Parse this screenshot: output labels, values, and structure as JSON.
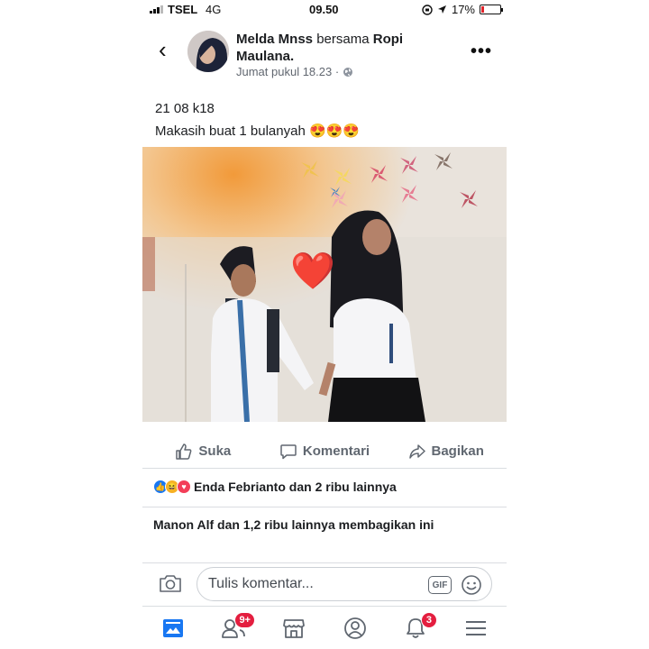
{
  "status_bar": {
    "carrier": "TSEL",
    "network": "4G",
    "time": "09.50",
    "battery": "17%",
    "battery_level": 0.17,
    "battery_color": "#e0242b"
  },
  "post": {
    "author": "Melda Mnss",
    "with_text": "bersama",
    "tagged": "Ropi Maulana.",
    "timestamp": "Jumat pukul 18.23 ·",
    "privacy_icon": "globe-icon",
    "text_line1": "21 08 k18",
    "text_line2": "Makasih buat 1 bulanyah",
    "emojis": "😍😍😍",
    "photo_overlay_emoji": "❤️"
  },
  "actions": {
    "like": "Suka",
    "comment": "Komentari",
    "share": "Bagikan"
  },
  "reactions": {
    "icons": [
      "like-reaction-icon",
      "haha-reaction-icon",
      "love-reaction-icon"
    ],
    "summary": "Enda Febrianto dan 2 ribu lainnya"
  },
  "shares": {
    "summary": "Manon Alf dan 1,2 ribu lainnya membagikan ini"
  },
  "comment_bar": {
    "placeholder": "Tulis komentar...",
    "gif_label": "GIF"
  },
  "bottom_nav": {
    "friends_badge": "9+",
    "notifications_badge": "3"
  },
  "colors": {
    "accent": "#1877f2",
    "badge": "#e41e3f",
    "love": "#f33e58",
    "haha": "#f7b125"
  }
}
